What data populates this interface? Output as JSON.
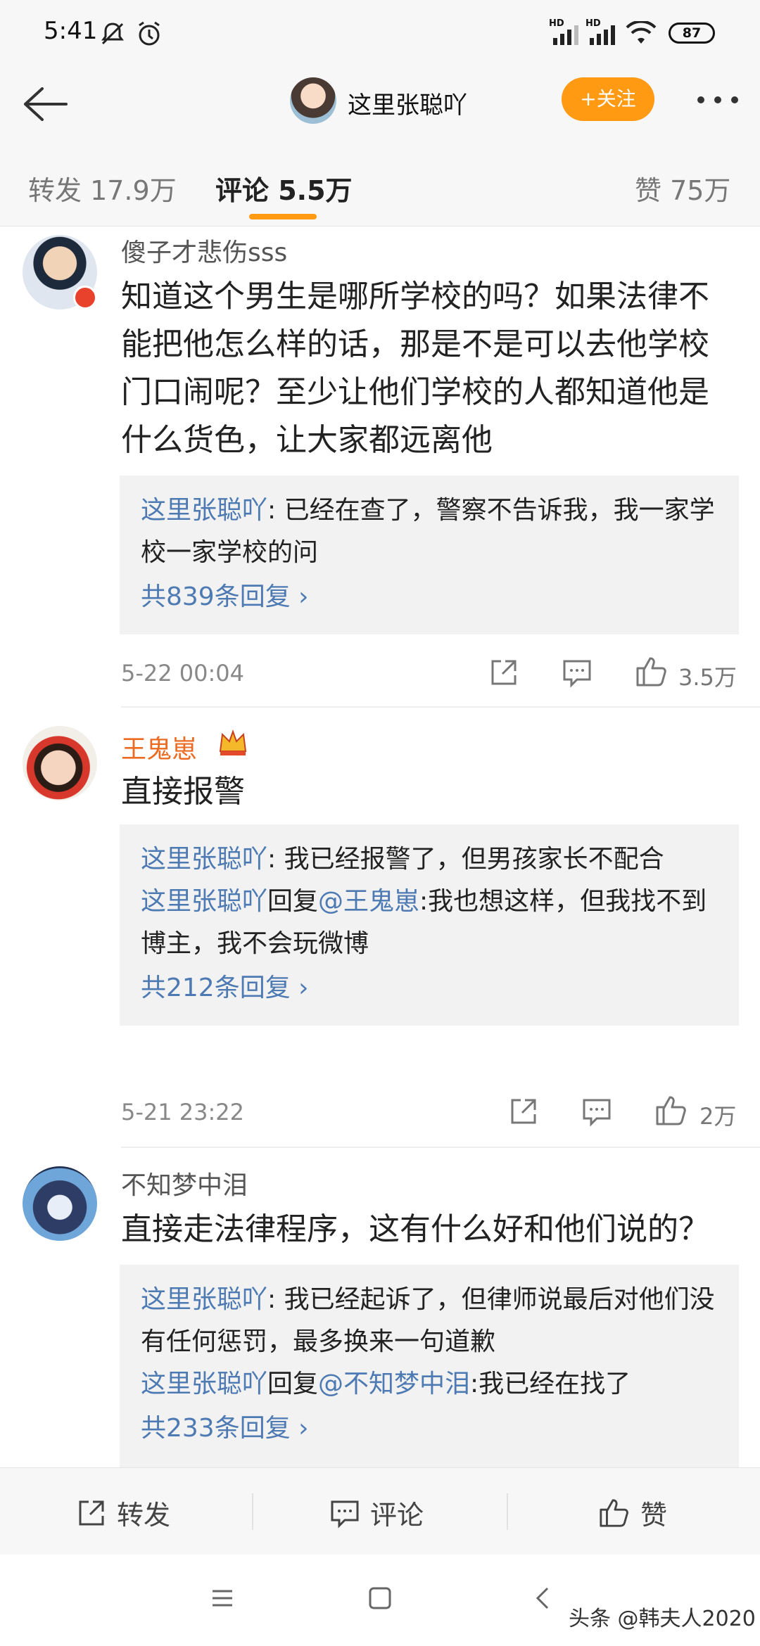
{
  "status_bar": {
    "time": "5:41",
    "signal_1": "HD",
    "signal_2": "HD",
    "battery": "87"
  },
  "header": {
    "title": "这里张聪吖",
    "follow_label": "+关注"
  },
  "tabs": {
    "repost": "转发 17.9万",
    "comment": "评论 5.5万",
    "like": "赞 75万"
  },
  "comments": [
    {
      "user": "傻子才悲伤sss",
      "text": "知道这个男生是哪所学校的吗？如果法律不能把他怎么样的话，那是不是可以去他学校门口闹呢？至少让他们学校的人都知道他是什么货色，让大家都远离他",
      "replies": [
        {
          "who": "这里张聪吖",
          "text": ": 已经在查了，警察不告诉我，我一家学校一家学校的问"
        }
      ],
      "reply_count": "共839条回复 ›",
      "time": "5-22 00:04",
      "likes": "3.5万"
    },
    {
      "user": "王鬼崽",
      "text": "直接报警",
      "replies": [
        {
          "who": "这里张聪吖",
          "text": ": 我已经报警了，但男孩家长不配合"
        },
        {
          "who": "这里张聪吖",
          "mid": "回复",
          "at": "@王鬼崽",
          "text": ":我也想这样，但我找不到博主，我不会玩微博"
        }
      ],
      "reply_count": "共212条回复 ›",
      "time": "5-21 23:22",
      "likes": "2万"
    },
    {
      "user": "不知梦中泪",
      "text": "直接走法律程序，这有什么好和他们说的？",
      "replies": [
        {
          "who": "这里张聪吖",
          "text": ": 我已经起诉了，但律师说最后对他们没有任何惩罚，最多换来一句道歉"
        },
        {
          "who": "这里张聪吖",
          "mid": "回复",
          "at": "@不知梦中泪",
          "text": ":我已经在找了"
        }
      ],
      "reply_count": "共233条回复 ›"
    }
  ],
  "action_bar": {
    "repost": "转发",
    "comment": "评论",
    "like": "赞"
  },
  "watermark": "头条 @韩夫人2020",
  "colors": {
    "accent": "#ff9a12",
    "link": "#4d7ab2",
    "vip_name": "#eb6b22"
  }
}
